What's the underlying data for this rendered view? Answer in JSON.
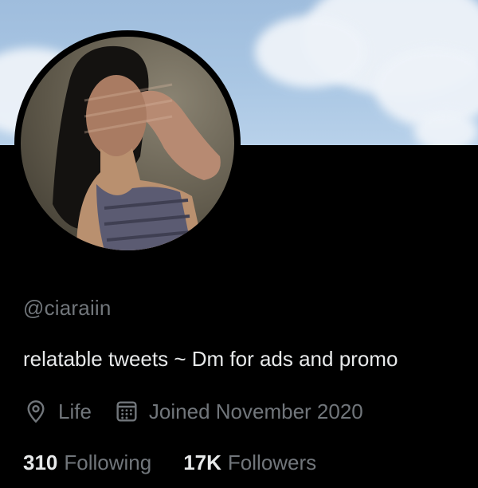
{
  "profile": {
    "handle": "@ciaraiin",
    "bio": "relatable tweets ~ Dm for ads and promo",
    "location": "Life",
    "joined": "Joined November 2020"
  },
  "stats": {
    "following_count": "310",
    "following_label": "Following",
    "followers_count": "17K",
    "followers_label": "Followers"
  },
  "icons": {
    "location": "location-pin-icon",
    "joined": "calendar-icon"
  },
  "colors": {
    "background": "#000000",
    "primary_text": "#e7e9ea",
    "secondary_text": "#71767b",
    "banner_sky": "#a9c6e3"
  }
}
